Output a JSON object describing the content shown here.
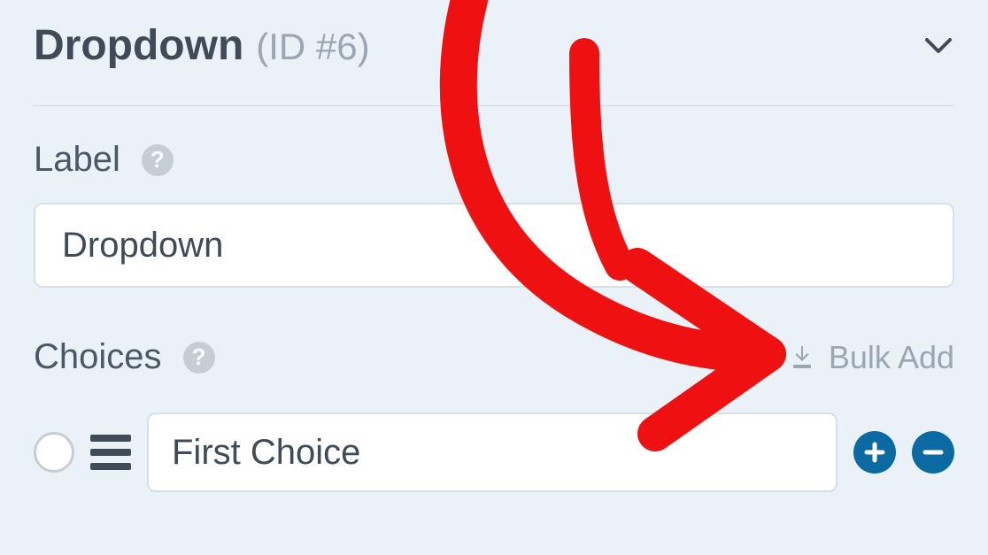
{
  "header": {
    "title": "Dropdown",
    "id_text": "(ID #6)"
  },
  "label_section": {
    "heading": "Label",
    "value": "Dropdown"
  },
  "choices_section": {
    "heading": "Choices",
    "bulk_add_label": "Bulk Add",
    "items": [
      {
        "value": "First Choice"
      }
    ]
  },
  "colors": {
    "accent_button": "#0a6aa1",
    "annotation": "#ef1111"
  }
}
